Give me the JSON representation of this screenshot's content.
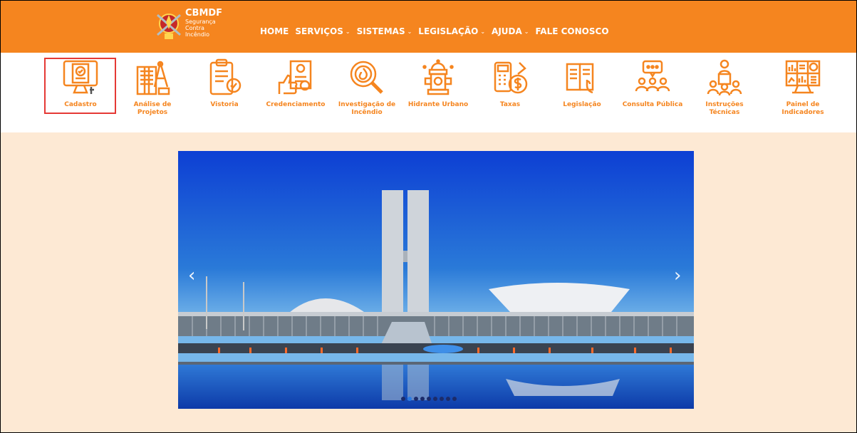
{
  "logo": {
    "title": "CBMDF",
    "sub1": "Segurança",
    "sub2": "Contra",
    "sub3": "Incêndio"
  },
  "nav": {
    "home": "HOME",
    "servicos": "SERVIÇOS",
    "sistemas": "SISTEMAS",
    "legislacao": "LEGISLAÇÃO",
    "ajuda": "AJUDA",
    "fale": "FALE CONOSCO"
  },
  "services": {
    "cadastro": "Cadastro",
    "analise_1": "Análise de",
    "analise_2": "Projetos",
    "vistoria": "Vistoria",
    "credenciamento": "Credenciamento",
    "investigacao_1": "Investigação de",
    "investigacao_2": "Incêndio",
    "hidrante": "Hidrante Urbano",
    "taxas": "Taxas",
    "legislacao": "Legislação",
    "consulta": "Consulta Pública",
    "instrucoes_1": "Instruções",
    "instrucoes_2": "Técnicas",
    "painel_1": "Painel de",
    "painel_2": "Indicadores"
  },
  "carousel": {
    "prev_glyph": "‹",
    "next_glyph": "›",
    "slide_count": 9,
    "active_slide": 2
  },
  "colors": {
    "brand_orange": "#f5851f",
    "page_bg": "#fde9d4",
    "highlight": "#e53935"
  }
}
